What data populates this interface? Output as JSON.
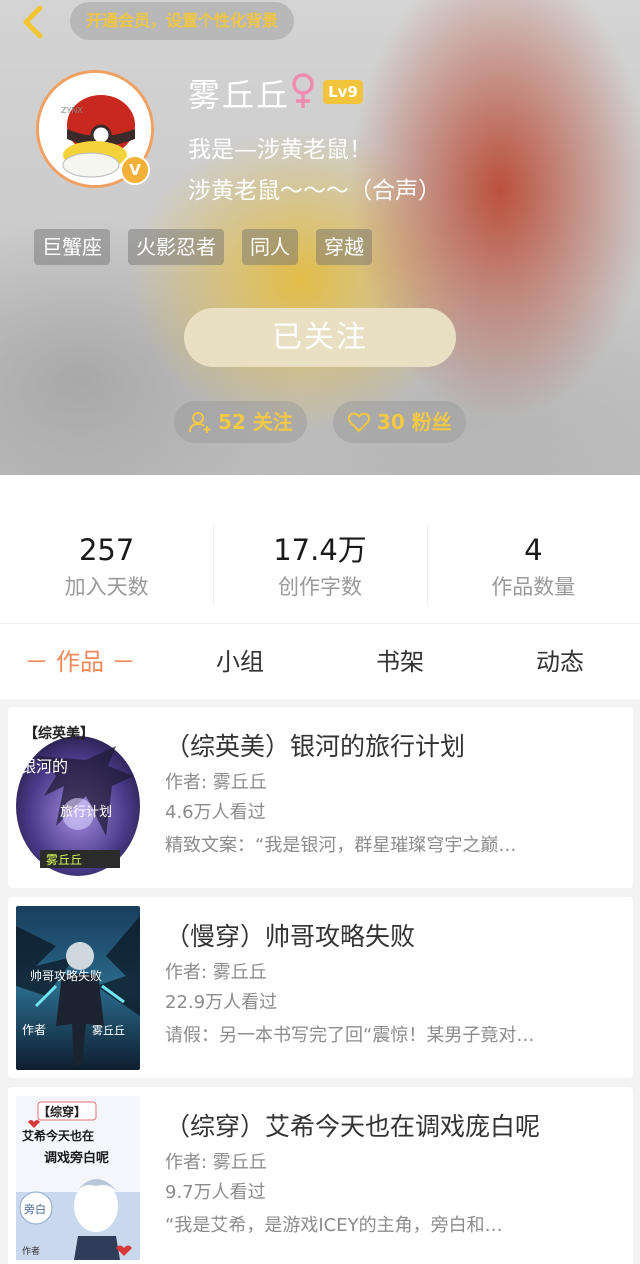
{
  "header": {
    "vip_banner": "开通会员，设置个性化背景",
    "username": "雾丘丘",
    "level": "Lv9",
    "vip_badge": "V",
    "bio": [
      "我是—涉黄老鼠！",
      "涉黄老鼠～～～（合声）"
    ],
    "tags": [
      "巨蟹座",
      "火影忍者",
      "同人",
      "穿越"
    ],
    "follow_button": "已关注",
    "following": "52 关注",
    "fans": "30 粉丝"
  },
  "stats": [
    {
      "value": "257",
      "label": "加入天数"
    },
    {
      "value": "17.4万",
      "label": "创作字数"
    },
    {
      "value": "4",
      "label": "作品数量"
    }
  ],
  "tabs": [
    "－ 作品 －",
    "小组",
    "书架",
    "动态"
  ],
  "books": [
    {
      "title": "（综英美）银河的旅行计划",
      "author": "作者: 雾丘丘",
      "views": "4.6万人看过",
      "blurb": "精致文案：“我是银河，群星璀璨穹宇之巅…",
      "cover_texts": [
        "【综英美】",
        "银河的",
        "旅行计划",
        "雾丘丘"
      ]
    },
    {
      "title": "（慢穿）帅哥攻略失败",
      "author": "作者: 雾丘丘",
      "views": "22.9万人看过",
      "blurb": "请假：另一本书写完了回“震惊！某男子竟对…",
      "cover_texts": [
        "帅哥攻略失败",
        "作者",
        "雾丘丘"
      ]
    },
    {
      "title": "（综穿）艾希今天也在调戏庞白呢",
      "author": "作者: 雾丘丘",
      "views": "9.7万人看过",
      "blurb": "“我是艾希，是游戏ICEY的主角，旁白和…",
      "cover_texts": [
        "【综穿】",
        "艾希今天也在",
        "调戏旁白呢",
        "旁白",
        "作者"
      ]
    }
  ],
  "colors": {
    "accent": "#f0895a",
    "gold": "#f3c842",
    "follow_bg": "#e9dfc2"
  }
}
